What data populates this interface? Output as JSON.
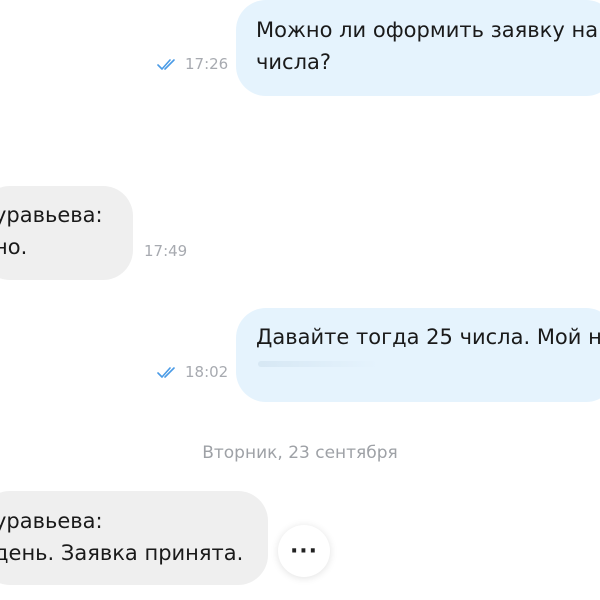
{
  "messages": [
    {
      "direction": "out",
      "text": "Можно ли оформить заявку на\nчисла?",
      "time": "17:26",
      "read": true
    },
    {
      "direction": "in",
      "text": "уравьева:\nно.",
      "time": "17:49"
    },
    {
      "direction": "out",
      "text": "Давайте тогда 25 числа. Мой н",
      "time": "18:02",
      "read": true
    },
    {
      "direction": "in",
      "text": "уравьева:\nдень. Заявка принята."
    }
  ],
  "date_separator": "Вторник, 23 сентября",
  "more_button": {
    "icon": "more-dots-icon",
    "label": "···"
  },
  "colors": {
    "outgoing_bubble": "#e5f3fd",
    "incoming_bubble": "#efefef",
    "read_check": "#4a9be6",
    "timestamp": "#a7aab0"
  }
}
